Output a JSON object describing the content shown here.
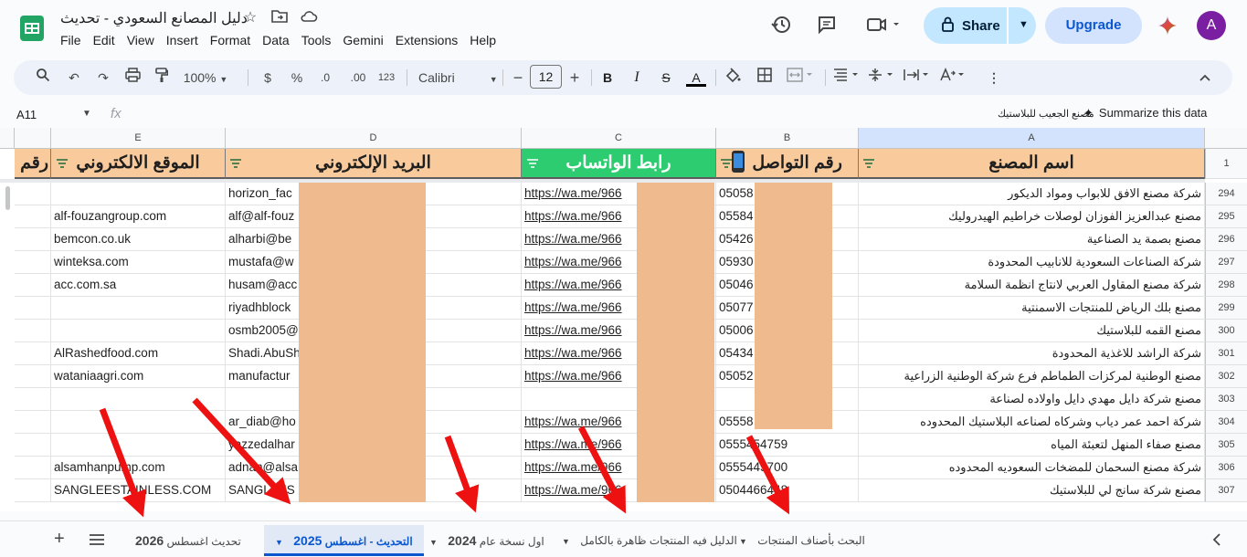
{
  "doc": {
    "title": "دليل المصانع السعودي - تحديث",
    "menu": [
      "File",
      "Edit",
      "View",
      "Insert",
      "Format",
      "Data",
      "Tools",
      "Gemini",
      "Extensions",
      "Help"
    ]
  },
  "header": {
    "share_label": "Share",
    "upgrade_label": "Upgrade",
    "avatar_letter": "A"
  },
  "toolbar": {
    "zoom": "100%",
    "currency": "$",
    "percent": "%",
    "dec_decrease": ".0",
    "dec_increase": ".00",
    "number_format": "123",
    "font": "Calibri",
    "font_size": "12",
    "bold": "B",
    "italic": "I",
    "text_color": "A"
  },
  "formula_bar": {
    "name_box": "A11",
    "fx": "fx",
    "content": "مصنع الجعيب للبلاستيك",
    "summarize": "Summarize this data"
  },
  "columns": [
    "E",
    "D",
    "C",
    "B",
    "A"
  ],
  "headers": {
    "A": "اسم المصنع",
    "B": "رقم التواصل",
    "C": "رابط الواتساب",
    "D": "البريد الإلكتروني",
    "E": "الموقع الالكتروني",
    "F": "رقم",
    "row1": "1"
  },
  "rows": [
    {
      "n": "294",
      "a": "شركة مصنع الافق للابواب ومواد الديكور",
      "b": "05058",
      "c": "https://wa.me/966",
      "d": "horizon_fac",
      "e": ""
    },
    {
      "n": "295",
      "a": "مصنع عبدالعزيز الفوزان لوصلات خراطيم الهيدروليك",
      "b": "05584",
      "c": "https://wa.me/966",
      "d": "alf@alf-fouz",
      "e": "alf-fouzangroup.com"
    },
    {
      "n": "296",
      "a": "مصنع بصمة يد الصناعية",
      "b": "05426",
      "c": "https://wa.me/966",
      "d": "alharbi@be",
      "e": "bemcon.co.uk"
    },
    {
      "n": "297",
      "a": "شركة الصناعات السعودية للانابيب المحدودة",
      "b": "05930",
      "c": "https://wa.me/966",
      "d": "mustafa@w",
      "e": "winteksa.com"
    },
    {
      "n": "298",
      "a": "شركة مصنع المقاول العربي لانتاج انظمة السلامة",
      "b": "05046",
      "c": "https://wa.me/966",
      "d": "husam@acc",
      "e": "acc.com.sa"
    },
    {
      "n": "299",
      "a": "مصنع بلك الرياض للمنتجات الاسمنتية",
      "b": "05077",
      "c": "https://wa.me/966",
      "d": "riyadhblock",
      "e": ""
    },
    {
      "n": "300",
      "a": "مصنع القمه للبلاستيك",
      "b": "05006",
      "c": "https://wa.me/966",
      "d": "osmb2005@",
      "e": ""
    },
    {
      "n": "301",
      "a": "شركة الراشد للاغذية المحدودة",
      "b": "05434",
      "c": "https://wa.me/966",
      "d": "Shadi.AbuSh                    od.com",
      "e": "AlRashedfood.com"
    },
    {
      "n": "302",
      "a": "مصنع الوطنية لمركزات الطماطم فرع شركة الوطنية الزراعية",
      "b": "05052",
      "c": "https://wa.me/966",
      "d": "manufactur",
      "e": "wataniaagri.com"
    },
    {
      "n": "303",
      "a": "مصنع شركة دايل مهدي دايل واولاده لصناعة",
      "b": "",
      "c": "",
      "d": "",
      "e": ""
    },
    {
      "n": "304",
      "a": "شركة احمد عمر دياب وشركاه لصناعه البلاستيك المحدوده",
      "b": "05558",
      "c": "https://wa.me/966",
      "d": "ar_diab@ho",
      "e": ""
    },
    {
      "n": "305",
      "a": "مصنع صفاء المنهل لتعبئة المياه",
      "b": "0555454759",
      "c": "https://wa.me/966",
      "d": "yazzedalhar",
      "e": ""
    },
    {
      "n": "306",
      "a": "شركة مصنع السحمان للمضخات السعوديه المحدوده",
      "b": "0555445700",
      "c": "https://wa.me/966",
      "d": "adnan@alsa",
      "e": "alsamhanpump.com"
    },
    {
      "n": "307",
      "a": "مصنع شركة سانج لي للبلاستيك",
      "b": "0504466448",
      "c": "https://wa.me/966",
      "d": "SANGLEES                    OM",
      "e": "SANGLEESTAINLESS.COM"
    }
  ],
  "sheets": [
    {
      "label": "البحث بأصناف المنتجات",
      "active": false
    },
    {
      "label": "الدليل فيه المنتجات ظاهرة بالكامل",
      "active": false
    },
    {
      "label": "اول نسخة عام",
      "year": "2024",
      "active": false
    },
    {
      "label": "التحديث - اغسطس",
      "year": "2025",
      "active": true
    },
    {
      "label": "تحديث اغسطس",
      "year": "2026",
      "active": false
    }
  ],
  "colors": {
    "header_orange": "#f9cb9c",
    "header_green": "#2ecc71",
    "annotation_red": "#ee1111",
    "redaction": "#efba8e"
  }
}
